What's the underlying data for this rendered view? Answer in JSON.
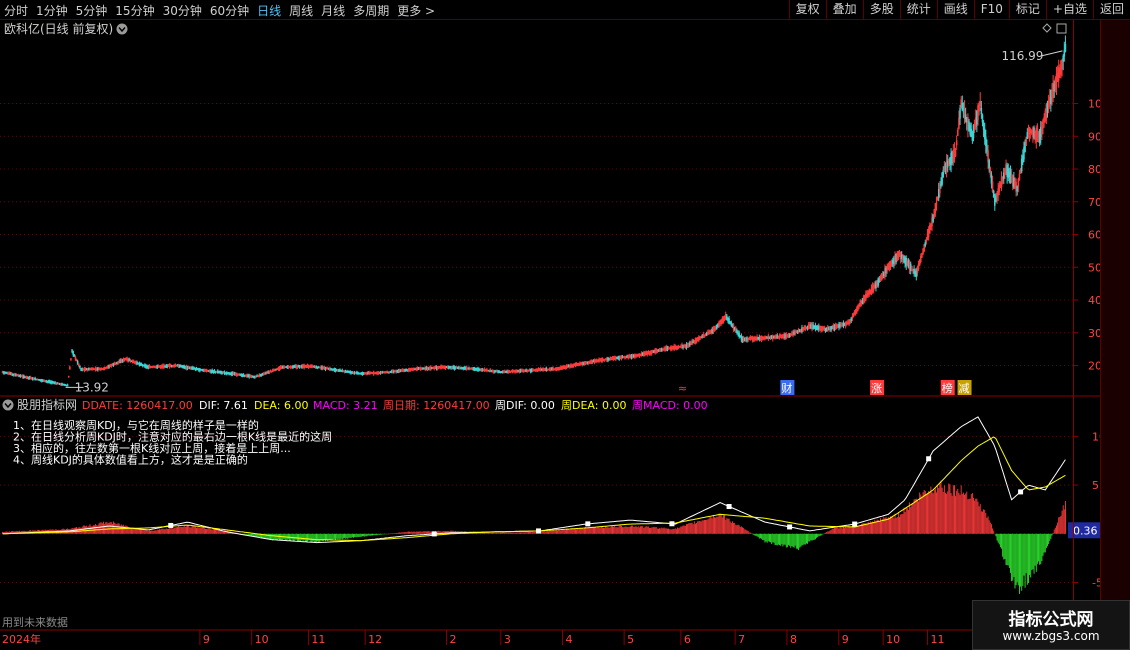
{
  "toolbar": {
    "periods": [
      "分时",
      "1分钟",
      "5分钟",
      "15分钟",
      "30分钟",
      "60分钟",
      "日线",
      "周线",
      "月线",
      "多周期",
      "更多 >"
    ],
    "active_period": "日线",
    "actions": [
      "复权",
      "叠加",
      "多股",
      "统计",
      "画线",
      "F10",
      "标记",
      "+自选",
      "返回"
    ]
  },
  "main_panel": {
    "title": "欧科亿(日线 前复权)",
    "high_label": "116.99",
    "low_label": "13.92",
    "event_tags": [
      "财",
      "涨",
      "榜",
      "减"
    ]
  },
  "indicator_panel": {
    "name": "股朋指标网",
    "values": [
      {
        "label": "DDATE: 1260417.00",
        "color": "#ff3b3b"
      },
      {
        "label": "DIF: 7.61",
        "color": "#ffffff"
      },
      {
        "label": "DEA: 6.00",
        "color": "#ffff00"
      },
      {
        "label": "MACD: 3.21",
        "color": "#ff00ff"
      },
      {
        "label": "周日期: 1260417.00",
        "color": "#ff3b3b"
      },
      {
        "label": "周DIF: 0.00",
        "color": "#ffffff"
      },
      {
        "label": "周DEA: 0.00",
        "color": "#ffff00"
      },
      {
        "label": "周MACD: 0.00",
        "color": "#ff00ff"
      }
    ],
    "notes": [
      "1、在日线观察周KDJ，与它在周线的样子是一样的",
      "2、在日线分析周KDJ时，注意对应的最右边一根K线是最近的这周",
      "3、相应的，往左数第一根K线对应上周，接着是上上周...",
      "4、周线KDJ的具体数值看上方，这才是是正确的"
    ],
    "current_value": "0.36",
    "future_note": "用到未来数据"
  },
  "x_axis": {
    "year": "2024年",
    "months": [
      "9",
      "10",
      "11",
      "12",
      "2",
      "3",
      "4",
      "5",
      "6",
      "7",
      "8",
      "9",
      "10",
      "11",
      "12",
      "1",
      "2"
    ]
  },
  "watermark": {
    "line1": "指标公式网",
    "line2": "www.zbgs3.com"
  },
  "colors": {
    "up": "#ff3b3b",
    "down": "#3ad6d6",
    "dif": "#ffffff",
    "dea": "#ffff00",
    "grid": "#6a0000",
    "axis": "#8a0000"
  },
  "chart_data": [
    {
      "type": "candlestick",
      "title": "欧科亿(日线 前复权)",
      "y_ticks": [
        20,
        30,
        40,
        50,
        60,
        70,
        80,
        90,
        100
      ],
      "ylim": [
        11,
        120
      ],
      "x_ticks": [
        "9",
        "10",
        "11",
        "12",
        "2",
        "3",
        "4",
        "5",
        "6",
        "7",
        "8",
        "9",
        "10",
        "11",
        "12",
        "1",
        "2"
      ],
      "price_path": [
        [
          0,
          18.0
        ],
        [
          20,
          16.5
        ],
        [
          45,
          14.8
        ],
        [
          58,
          13.92
        ],
        [
          62,
          24.5
        ],
        [
          70,
          18.8
        ],
        [
          90,
          19.0
        ],
        [
          110,
          22.0
        ],
        [
          130,
          19.5
        ],
        [
          155,
          20.0
        ],
        [
          180,
          18.5
        ],
        [
          205,
          17.5
        ],
        [
          225,
          16.5
        ],
        [
          250,
          19.5
        ],
        [
          275,
          19.8
        ],
        [
          300,
          18.5
        ],
        [
          320,
          17.5
        ],
        [
          345,
          18.0
        ],
        [
          370,
          19.0
        ],
        [
          395,
          19.5
        ],
        [
          420,
          19.0
        ],
        [
          445,
          18.0
        ],
        [
          470,
          18.5
        ],
        [
          495,
          19.0
        ],
        [
          515,
          20.5
        ],
        [
          540,
          22.0
        ],
        [
          565,
          23.0
        ],
        [
          590,
          25.0
        ],
        [
          610,
          26.0
        ],
        [
          635,
          31.0
        ],
        [
          645,
          35.0
        ],
        [
          660,
          28.0
        ],
        [
          680,
          28.5
        ],
        [
          700,
          29.0
        ],
        [
          720,
          32.0
        ],
        [
          735,
          31.0
        ],
        [
          755,
          33.0
        ],
        [
          765,
          39.0
        ],
        [
          780,
          45.0
        ],
        [
          790,
          50.0
        ],
        [
          800,
          54.0
        ],
        [
          815,
          48.0
        ],
        [
          830,
          65.0
        ],
        [
          840,
          80.0
        ],
        [
          850,
          85.0
        ],
        [
          855,
          100.0
        ],
        [
          865,
          90.0
        ],
        [
          872,
          100.0
        ],
        [
          885,
          70.0
        ],
        [
          895,
          80.0
        ],
        [
          905,
          74.0
        ],
        [
          915,
          92.0
        ],
        [
          925,
          90.0
        ],
        [
          933,
          100.0
        ],
        [
          945,
          112.0
        ],
        [
          948,
          116.99
        ]
      ],
      "high": 116.99,
      "low": 13.92,
      "events": [
        "财",
        "涨",
        "榜",
        "减"
      ]
    },
    {
      "type": "bar",
      "title": "股朋指标网",
      "series": [
        {
          "name": "DIF",
          "type": "line",
          "color": "#ffffff",
          "values": [
            [
              0,
              0.0
            ],
            [
              60,
              0.3
            ],
            [
              95,
              0.8
            ],
            [
              130,
              0.4
            ],
            [
              165,
              1.2
            ],
            [
              200,
              0.2
            ],
            [
              240,
              -0.6
            ],
            [
              280,
              -0.9
            ],
            [
              320,
              -0.7
            ],
            [
              360,
              -0.2
            ],
            [
              400,
              0.1
            ],
            [
              440,
              0.2
            ],
            [
              480,
              0.3
            ],
            [
              520,
              1.0
            ],
            [
              560,
              1.4
            ],
            [
              600,
              1.0
            ],
            [
              640,
              3.2
            ],
            [
              680,
              1.2
            ],
            [
              720,
              0.3
            ],
            [
              760,
              1.0
            ],
            [
              790,
              2.0
            ],
            [
              805,
              3.5
            ],
            [
              830,
              8.5
            ],
            [
              855,
              11.0
            ],
            [
              870,
              12.0
            ],
            [
              885,
              9.0
            ],
            [
              900,
              3.5
            ],
            [
              915,
              5.0
            ],
            [
              930,
              4.5
            ],
            [
              948,
              7.61
            ]
          ]
        },
        {
          "name": "DEA",
          "type": "line",
          "color": "#ffff00",
          "values": [
            [
              0,
              0.0
            ],
            [
              60,
              0.2
            ],
            [
              95,
              0.5
            ],
            [
              130,
              0.6
            ],
            [
              165,
              0.9
            ],
            [
              200,
              0.4
            ],
            [
              240,
              -0.2
            ],
            [
              280,
              -0.6
            ],
            [
              320,
              -0.7
            ],
            [
              360,
              -0.4
            ],
            [
              400,
              0.0
            ],
            [
              440,
              0.2
            ],
            [
              480,
              0.3
            ],
            [
              520,
              0.6
            ],
            [
              560,
              1.0
            ],
            [
              600,
              1.1
            ],
            [
              640,
              2.0
            ],
            [
              680,
              1.6
            ],
            [
              720,
              0.8
            ],
            [
              760,
              0.7
            ],
            [
              790,
              1.5
            ],
            [
              805,
              2.6
            ],
            [
              830,
              4.5
            ],
            [
              855,
              7.5
            ],
            [
              870,
              9.0
            ],
            [
              885,
              10.0
            ],
            [
              900,
              6.5
            ],
            [
              915,
              4.5
            ],
            [
              930,
              4.8
            ],
            [
              948,
              6.0
            ]
          ]
        }
      ],
      "macd_hist": [
        [
          0,
          0.2
        ],
        [
          60,
          0.5
        ],
        [
          95,
          1.2
        ],
        [
          130,
          0.3
        ],
        [
          165,
          0.8
        ],
        [
          200,
          0.3
        ],
        [
          240,
          -0.6
        ],
        [
          280,
          -0.8
        ],
        [
          320,
          -0.3
        ],
        [
          360,
          0.2
        ],
        [
          400,
          0.3
        ],
        [
          440,
          0.1
        ],
        [
          480,
          0.2
        ],
        [
          520,
          0.6
        ],
        [
          560,
          0.8
        ],
        [
          600,
          0.5
        ],
        [
          640,
          2.0
        ],
        [
          680,
          -0.8
        ],
        [
          710,
          -1.5
        ],
        [
          740,
          0.5
        ],
        [
          770,
          1.0
        ],
        [
          800,
          2.0
        ],
        [
          820,
          4.0
        ],
        [
          835,
          5.0
        ],
        [
          850,
          4.5
        ],
        [
          865,
          4.0
        ],
        [
          880,
          1.5
        ],
        [
          890,
          -1.5
        ],
        [
          905,
          -5.6
        ],
        [
          920,
          -4.0
        ],
        [
          930,
          -2.0
        ],
        [
          940,
          1.0
        ],
        [
          948,
          3.21
        ]
      ],
      "y_ticks": [
        -5.0,
        0.0,
        5.0,
        10.0
      ],
      "ylim": [
        -7.0,
        12.5
      ],
      "current_value": 0.36
    }
  ]
}
